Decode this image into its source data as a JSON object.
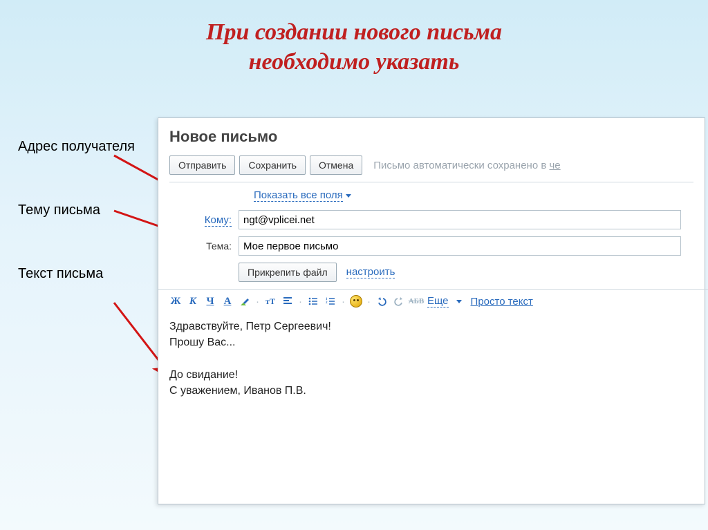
{
  "title_line1": "При создании нового письма",
  "title_line2": "необходимо указать",
  "labels": {
    "recipient": "Адрес получателя",
    "subject": "Тему письма",
    "body": "Текст письма"
  },
  "composer": {
    "title": "Новое письмо",
    "toolbar": {
      "send": "Отправить",
      "save": "Сохранить",
      "cancel": "Отмена",
      "autosave_prefix": "Письмо автоматически сохранено в ",
      "autosave_link": "че"
    },
    "show_all_fields": "Показать все поля",
    "to_label": "Кому:",
    "to_value": "ngt@vplicei.net",
    "subject_label": "Тема:",
    "subject_value": "Мое первое письмо",
    "attach_button": "Прикрепить файл",
    "configure_link": "настроить",
    "format": {
      "bold": "Ж",
      "italic": "К",
      "underline": "Ч",
      "font": "А",
      "highlight_icon": "highlight-icon",
      "size_dec": "тТ",
      "align_icon": "align-icon",
      "list_icon": "list-icon",
      "numlist_icon": "numlist-icon",
      "smiley_icon": "smiley-icon",
      "undo_icon": "undo-icon",
      "redo_icon": "redo-icon",
      "strike": "АБВ",
      "more": "Еще",
      "plain": "Просто текст"
    },
    "body": "Здравствуйте, Петр Сергеевич!\nПрошу Вас...\n\nДо свидание!\nС уважением, Иванов П.В."
  }
}
